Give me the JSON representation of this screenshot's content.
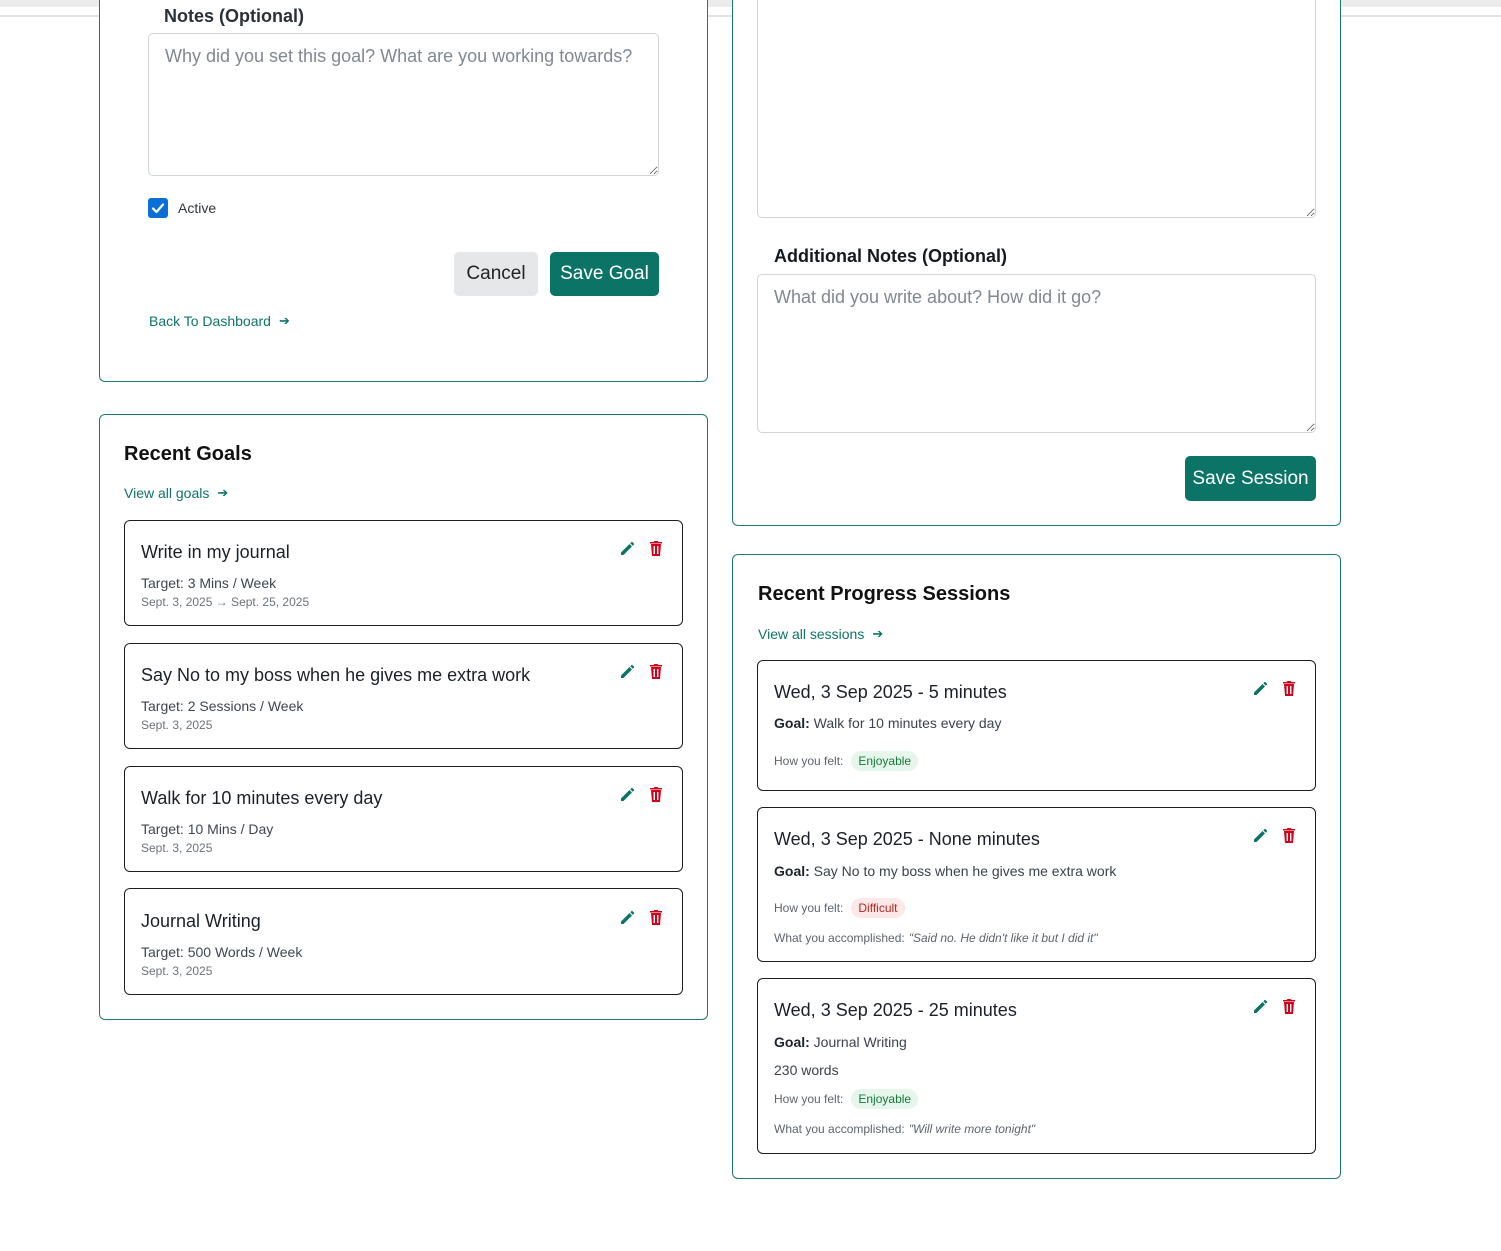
{
  "goal_form": {
    "notes_label": "Notes (Optional)",
    "notes_placeholder": "Why did you set this goal? What are you working towards?",
    "active_label": "Active",
    "active_checked": true,
    "cancel_label": "Cancel",
    "save_label": "Save Goal",
    "back_link": "Back To Dashboard",
    "back_arrow_icon": "arrow-right-icon"
  },
  "session_form": {
    "additional_notes_label": "Additional Notes (Optional)",
    "additional_notes_placeholder": "What did you write about? How did it go?",
    "save_label": "Save Session"
  },
  "recent_goals": {
    "title": "Recent Goals",
    "view_all": "View all goals",
    "items": [
      {
        "title": "Write in my journal",
        "target": "Target: 3 Mins / Week",
        "date": "Sept. 3, 2025 → Sept. 25, 2025"
      },
      {
        "title": "Say No to my boss when he gives me extra work",
        "target": "Target: 2 Sessions / Week",
        "date": "Sept. 3, 2025"
      },
      {
        "title": "Walk for 10 minutes every day",
        "target": "Target: 10 Mins / Day",
        "date": "Sept. 3, 2025"
      },
      {
        "title": "Journal Writing",
        "target": "Target: 500 Words / Week",
        "date": "Sept. 3, 2025"
      }
    ]
  },
  "recent_sessions": {
    "title": "Recent Progress Sessions",
    "view_all": "View all sessions",
    "goal_prefix": "Goal:",
    "felt_prefix": "How you felt:",
    "accomplished_prefix": "What you accomplished:",
    "items": [
      {
        "title": "Wed, 3 Sep 2025 - 5 minutes",
        "goal": "Walk for 10 minutes every day",
        "felt": "Enjoyable"
      },
      {
        "title": "Wed, 3 Sep 2025 - None minutes",
        "goal": "Say No to my boss when he gives me extra work",
        "felt": "Difficult",
        "accomplished": "\"Said no. He didn't like it but I did it\""
      },
      {
        "title": "Wed, 3 Sep 2025 - 25 minutes",
        "goal": "Journal Writing",
        "words": "230 words",
        "felt": "Enjoyable",
        "accomplished": "\"Will write more tonight\""
      }
    ]
  },
  "colors": {
    "accent": "#0b7466",
    "danger": "#d0021b",
    "badge_good_bg": "#e6f6ea",
    "badge_bad_bg": "#fde8e8"
  },
  "icons": {
    "edit": "pencil-icon",
    "delete": "trash-icon",
    "arrow": "arrow-right-icon"
  }
}
